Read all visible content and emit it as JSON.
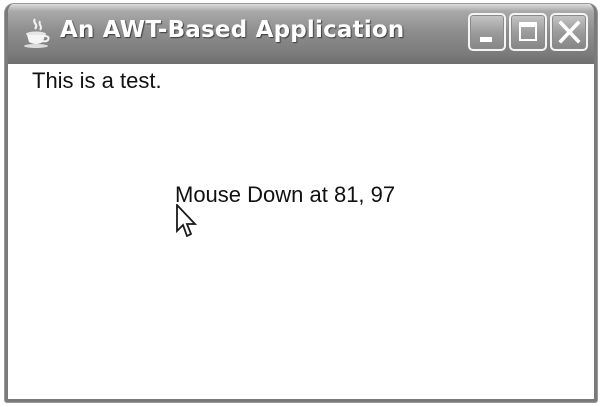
{
  "window": {
    "title": "An AWT-Based Application",
    "icon": "java-coffee-cup-icon"
  },
  "title_buttons": {
    "minimize_icon": "minimize-icon",
    "maximize_icon": "maximize-icon",
    "close_icon": "close-icon"
  },
  "content": {
    "label_text": "This is a test.",
    "mouse_message": "Mouse Down at 81, 97",
    "cursor_icon": "mouse-pointer-icon"
  },
  "colors": {
    "titlebar": "#8e8e8e",
    "title_text": "#ffffff",
    "background": "#ffffff",
    "text": "#111111"
  }
}
